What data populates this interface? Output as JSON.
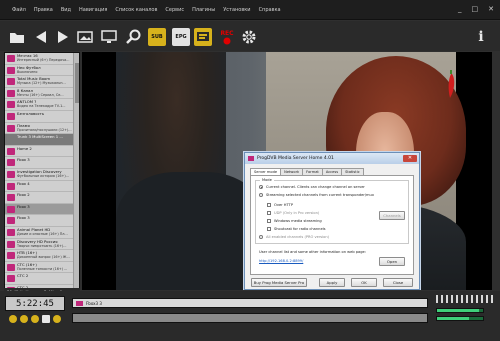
{
  "menu": [
    "Файл",
    "Правка",
    "Вид",
    "Навигация",
    "Список каналов",
    "Сервис",
    "Плагины",
    "Установки",
    "Справка"
  ],
  "window_buttons": [
    "_",
    "□",
    "✕"
  ],
  "toolbar": {
    "sub_label": "SUB",
    "epg_label": "EPG",
    "rec_label": "REC",
    "info_label": "i"
  },
  "channels": [
    {
      "name": "Мечтах 16",
      "program": "Интересный (6+) Передача...",
      "type": "normal"
    },
    {
      "name": "Нео Футбол",
      "program": "Выключено",
      "type": "normal"
    },
    {
      "name": "Total Music Boom",
      "program": "Музыка (12+) Музыкальн...",
      "type": "normal"
    },
    {
      "name": "8 Канал",
      "program": "Мечты (16+) Сериал, Се...",
      "type": "normal"
    },
    {
      "name": "ANTLOM ?",
      "program": "Видео на Телекадре TV-1...",
      "type": "normal"
    },
    {
      "name": "Безголовость",
      "program": "",
      "type": "normal"
    },
    {
      "name": "Пламя",
      "program": "Прочитали/послушали (12+)...",
      "type": "normal"
    },
    {
      "name": "Trunk 3 MultiScreen 1 ...",
      "program": "",
      "type": "group"
    },
    {
      "name": "Home 2",
      "program": "",
      "type": "normal"
    },
    {
      "name": "Fbox 3",
      "program": "",
      "type": "normal"
    },
    {
      "name": "Investigation Discovery",
      "program": "Футбольные история (16+)...",
      "type": "normal"
    },
    {
      "name": "Fbox 4",
      "program": "",
      "type": "normal"
    },
    {
      "name": "Fbox 2",
      "program": "",
      "type": "normal"
    },
    {
      "name": "Fbox 3",
      "program": "",
      "type": "sel"
    },
    {
      "name": "Fbox 3",
      "program": "",
      "type": "normal"
    },
    {
      "name": "Animal Planet HD",
      "program": "Дикие и опасные (16+) Пл...",
      "type": "normal"
    },
    {
      "name": "Discovery HD Россия",
      "program": "Творчи нимрстьють (16+)...",
      "type": "normal"
    },
    {
      "name": "НТВ (16+)",
      "program": "Дикоенный вопрос (16+) Ж...",
      "type": "normal"
    },
    {
      "name": "СТС (16+)",
      "program": "Полезные тонкости (16+) ...",
      "type": "normal"
    },
    {
      "name": "СТС 2",
      "program": "",
      "type": "normal"
    },
    {
      "name": "СТС 2",
      "program": "",
      "type": "normal"
    }
  ],
  "left_status": "20:41 (): Новость 2, Mirsoft",
  "dialog": {
    "title": "ProgDVB Media Server Home 4.01",
    "close": "✕",
    "tabs": [
      "Server mode",
      "Network",
      "Format",
      "Access",
      "Statistic"
    ],
    "mode_legend": "Mode",
    "options": [
      {
        "label": "Current channel. Clients can change channel on server",
        "kind": "radio",
        "on": true,
        "dim": false
      },
      {
        "label": "Streaming selected channels from current transponder/mux",
        "kind": "radio",
        "on": false,
        "dim": false
      },
      {
        "label": "Over HTTP",
        "kind": "check",
        "on": false,
        "dim": false
      },
      {
        "label": "UDP (Only in Pro version)",
        "kind": "check",
        "on": false,
        "dim": true
      },
      {
        "label": "Windows media streaming",
        "kind": "check",
        "on": false,
        "dim": false
      },
      {
        "label": "Shoutcast for radio channels",
        "kind": "check",
        "on": false,
        "dim": false
      },
      {
        "label": "All enabled channels (PRO version)",
        "kind": "radio",
        "on": false,
        "dim": true
      }
    ],
    "channels_btn": "Channels",
    "note": "User channel list and some other information on web page:",
    "link": "http://192.168.0.2:8899/",
    "open_btn": "Open",
    "buy_btn": "Buy Prog Media Server Pro",
    "apply_btn": "Apply",
    "ok_btn": "OK",
    "close_btn": "Close"
  },
  "player": {
    "clock": "5:22:45",
    "now_playing": "Fbox3 3",
    "seek_fraction": 0.0,
    "volume_fraction": 0.92,
    "volume2_fraction": 0.7
  },
  "colors": {
    "accent": "#d7b21c",
    "channel_icon": "#c0277a",
    "volume": "#3fcf7a"
  }
}
